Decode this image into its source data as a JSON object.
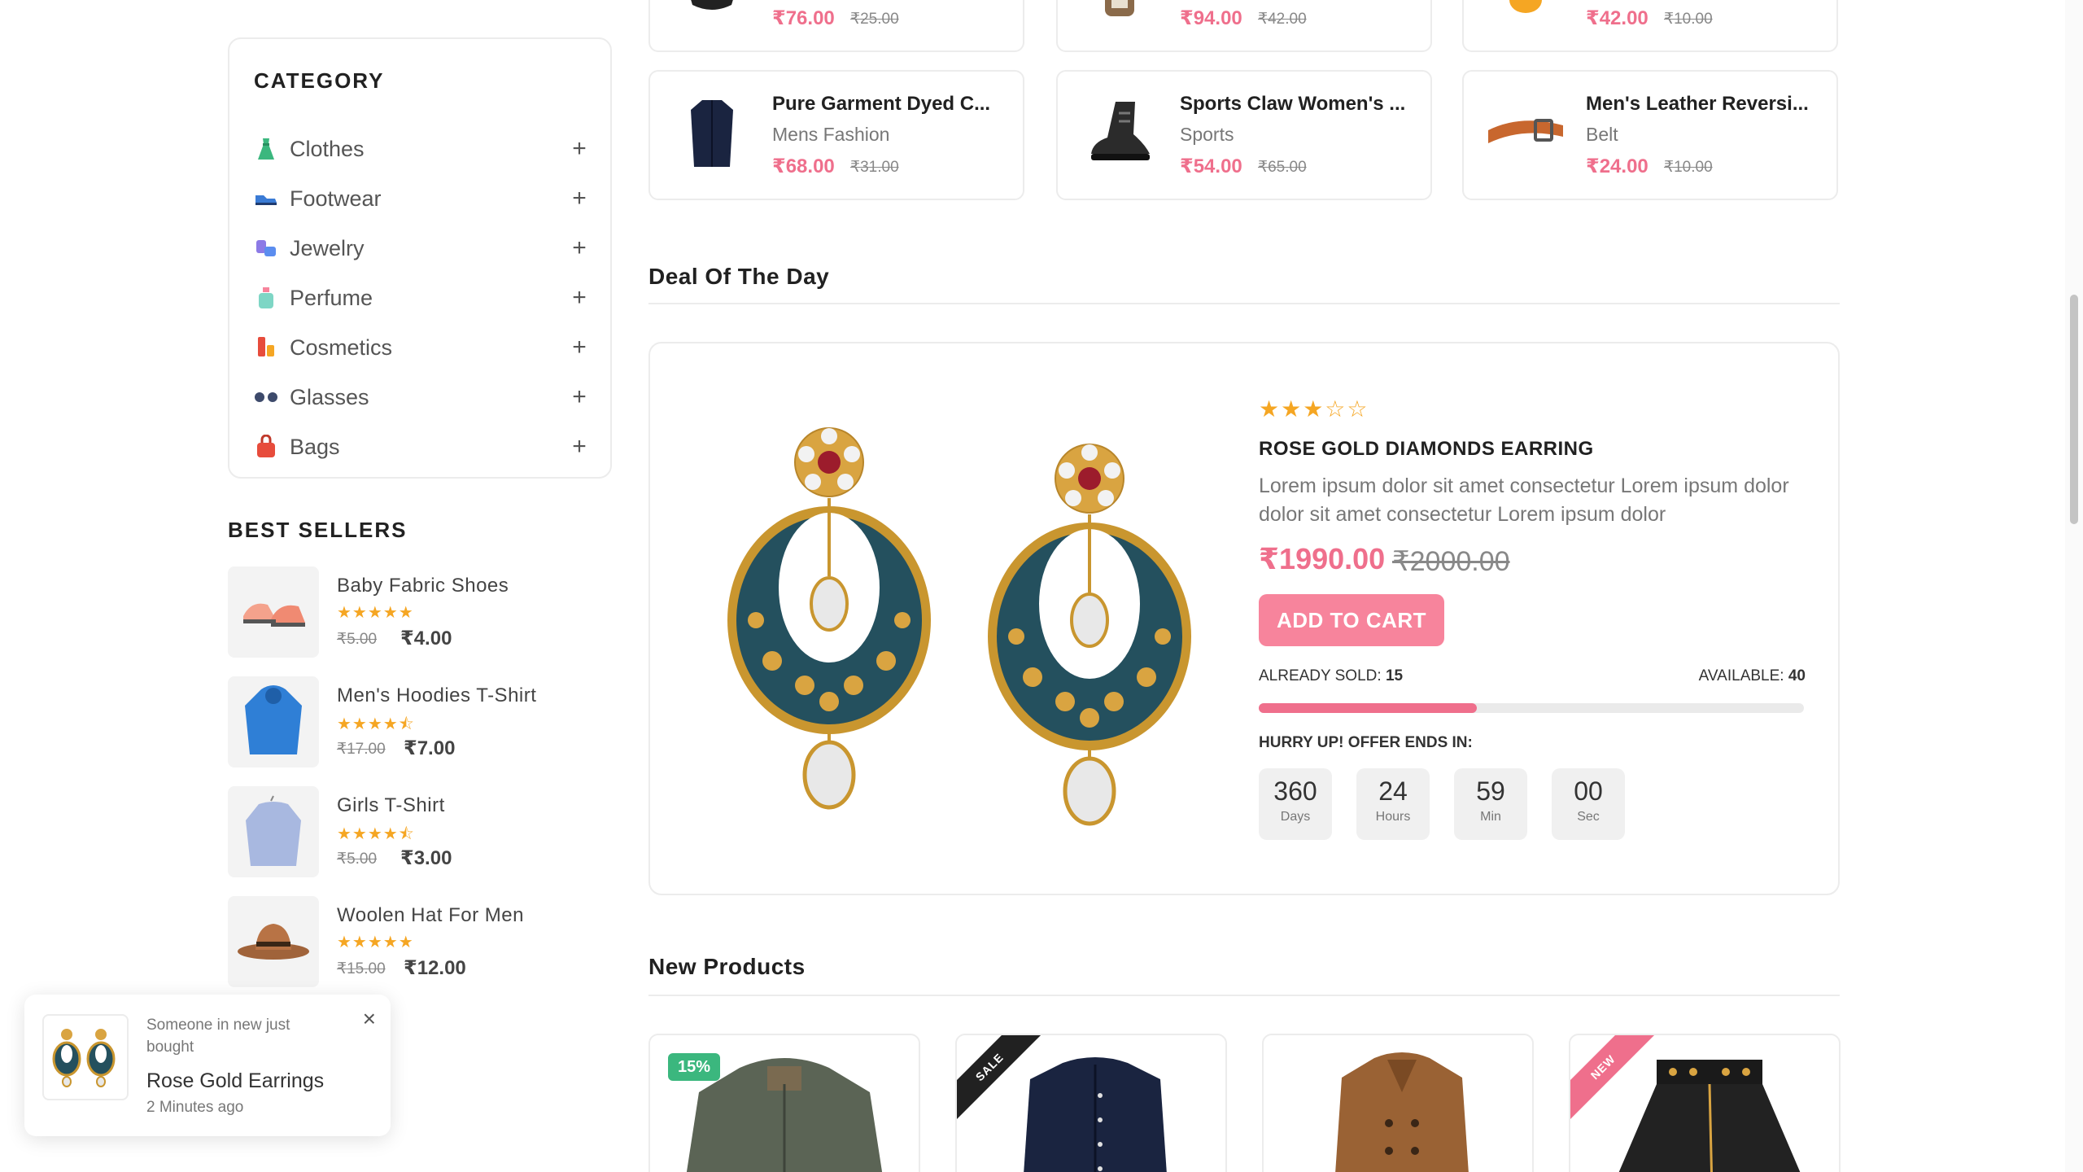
{
  "sidebar": {
    "category_title": "CATEGORY",
    "categories": [
      {
        "label": "Clothes",
        "icon": "dress-icon"
      },
      {
        "label": "Footwear",
        "icon": "shoe-icon"
      },
      {
        "label": "Jewelry",
        "icon": "jewelry-icon"
      },
      {
        "label": "Perfume",
        "icon": "perfume-icon"
      },
      {
        "label": "Cosmetics",
        "icon": "cosmetics-icon"
      },
      {
        "label": "Glasses",
        "icon": "glasses-icon"
      },
      {
        "label": "Bags",
        "icon": "bag-icon"
      }
    ],
    "expand_symbol": "+",
    "best_sellers_title": "BEST SELLERS",
    "best_sellers": [
      {
        "name": "Baby Fabric Shoes",
        "rating": 5,
        "stars": "★★★★★",
        "old_price": "₹5.00",
        "price": "₹4.00"
      },
      {
        "name": "Men's Hoodies T-Shirt",
        "rating": 4.5,
        "stars": "★★★★⯪",
        "old_price": "₹17.00",
        "price": "₹7.00"
      },
      {
        "name": "Girls T-Shirt",
        "rating": 4.5,
        "stars": "★★★★⯪",
        "old_price": "₹5.00",
        "price": "₹3.00"
      },
      {
        "name": "Woolen Hat For Men",
        "rating": 5,
        "stars": "★★★★★",
        "old_price": "₹15.00",
        "price": "₹12.00"
      }
    ]
  },
  "top_products_partial": [
    {
      "price": "₹76.00",
      "old_price": "₹25.00"
    },
    {
      "price": "₹94.00",
      "old_price": "₹42.00"
    },
    {
      "price": "₹42.00",
      "old_price": "₹10.00"
    }
  ],
  "top_products": [
    {
      "title": "Pure Garment Dyed C...",
      "category": "Mens Fashion",
      "price": "₹68.00",
      "old_price": "₹31.00"
    },
    {
      "title": "Sports Claw Women's ...",
      "category": "Sports",
      "price": "₹54.00",
      "old_price": "₹65.00"
    },
    {
      "title": "Men's Leather Reversi...",
      "category": "Belt",
      "price": "₹24.00",
      "old_price": "₹10.00"
    }
  ],
  "deal": {
    "section_title": "Deal Of The Day",
    "rating": 3,
    "stars": "★★★☆☆",
    "name": "ROSE GOLD DIAMONDS EARRING",
    "description": "Lorem ipsum dolor sit amet consectetur Lorem ipsum dolor dolor sit amet consectetur Lorem ipsum dolor",
    "price": "₹1990.00",
    "old_price": "₹2000.00",
    "cart_button": "ADD TO CART",
    "sold_label": "ALREADY SOLD:",
    "sold": "15",
    "available_label": "AVAILABLE:",
    "available": "40",
    "stock_progress": 0.4,
    "hurry_text": "HURRY UP! OFFER ENDS IN:",
    "countdown": [
      {
        "value": "360",
        "label": "Days"
      },
      {
        "value": "24",
        "label": "Hours"
      },
      {
        "value": "59",
        "label": "Min"
      },
      {
        "value": "00",
        "label": "Sec"
      }
    ]
  },
  "new_products": {
    "section_title": "New Products",
    "badges": [
      "15%",
      "SALE",
      "",
      "NEW"
    ]
  },
  "toast": {
    "message": "Someone in new just bought",
    "product": "Rose Gold Earrings",
    "time": "2 Minutes ago",
    "close": "×"
  },
  "colors": {
    "accent_pink": "#ef6f8c",
    "button_pink": "#f7849c",
    "star": "#f5a623",
    "badge_green": "#3bb77e",
    "ribbon_dark": "#212121",
    "ribbon_pink": "#ef6f8c"
  }
}
